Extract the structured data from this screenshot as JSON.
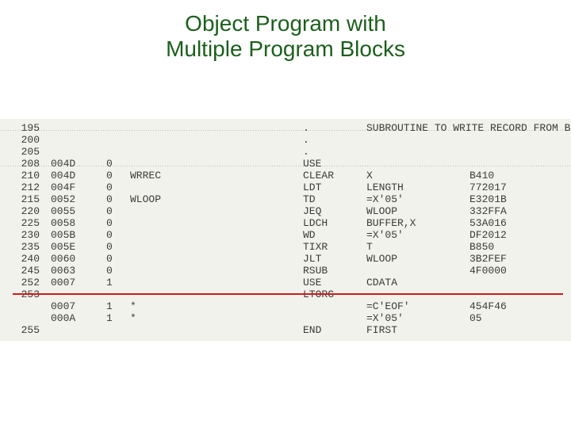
{
  "title_line1": "Object Program with",
  "title_line2": "Multiple Program Blocks",
  "rows": [
    {
      "dotted": true,
      "line": "195",
      "loc": "",
      "blk": "",
      "label": "",
      "empty": "",
      "opcode": ".",
      "operand": "SUBROUTINE TO WRITE RECORD FROM BUFFER",
      "obj": ""
    },
    {
      "dotted": false,
      "line": "200",
      "loc": "",
      "blk": "",
      "label": "",
      "empty": "",
      "opcode": ".",
      "operand": "",
      "obj": ""
    },
    {
      "dotted": false,
      "line": "205",
      "loc": "",
      "blk": "",
      "label": "",
      "empty": "",
      "opcode": ".",
      "operand": "",
      "obj": ""
    },
    {
      "dotted": true,
      "line": "208",
      "loc": "004D",
      "blk": "0",
      "label": "",
      "empty": "",
      "opcode": "USE",
      "operand": "",
      "obj": ""
    },
    {
      "dotted": false,
      "line": "210",
      "loc": "004D",
      "blk": "0",
      "label": "WRREC",
      "empty": "",
      "opcode": "CLEAR",
      "operand": "X",
      "obj": "B410"
    },
    {
      "dotted": false,
      "line": "212",
      "loc": "004F",
      "blk": "0",
      "label": "",
      "empty": "",
      "opcode": "LDT",
      "operand": "LENGTH",
      "obj": "772017"
    },
    {
      "dotted": false,
      "line": "215",
      "loc": "0052",
      "blk": "0",
      "label": "WLOOP",
      "empty": "",
      "opcode": "TD",
      "operand": "=X'05'",
      "obj": "E3201B"
    },
    {
      "dotted": false,
      "line": "220",
      "loc": "0055",
      "blk": "0",
      "label": "",
      "empty": "",
      "opcode": "JEQ",
      "operand": "WLOOP",
      "obj": "332FFA"
    },
    {
      "dotted": false,
      "line": "225",
      "loc": "0058",
      "blk": "0",
      "label": "",
      "empty": "",
      "opcode": "LDCH",
      "operand": "BUFFER,X",
      "obj": "53A016"
    },
    {
      "dotted": false,
      "line": "230",
      "loc": "005B",
      "blk": "0",
      "label": "",
      "empty": "",
      "opcode": "WD",
      "operand": "=X'05'",
      "obj": "DF2012"
    },
    {
      "dotted": false,
      "line": "235",
      "loc": "005E",
      "blk": "0",
      "label": "",
      "empty": "",
      "opcode": "TIXR",
      "operand": "T",
      "obj": "B850"
    },
    {
      "dotted": false,
      "line": "240",
      "loc": "0060",
      "blk": "0",
      "label": "",
      "empty": "",
      "opcode": "JLT",
      "operand": "WLOOP",
      "obj": "3B2FEF"
    },
    {
      "dotted": false,
      "line": "245",
      "loc": "0063",
      "blk": "0",
      "label": "",
      "empty": "",
      "opcode": "RSUB",
      "operand": "",
      "obj": "4F0000"
    },
    {
      "dotted": false,
      "line": "252",
      "loc": "0007",
      "blk": "1",
      "label": "",
      "empty": "",
      "opcode": "USE",
      "operand": "CDATA",
      "obj": ""
    },
    {
      "dotted": false,
      "line": "253",
      "loc": "",
      "blk": "",
      "label": "",
      "empty": "",
      "opcode": "LTORG",
      "operand": "",
      "obj": ""
    },
    {
      "dotted": false,
      "line": "",
      "loc": "0007",
      "blk": "1",
      "label": "*",
      "empty": "",
      "opcode": "",
      "operand": "=C'EOF'",
      "obj": "454F46"
    },
    {
      "dotted": false,
      "line": "",
      "loc": "000A",
      "blk": "1",
      "label": "*",
      "empty": "",
      "opcode": "",
      "operand": "=X'05'",
      "obj": "05"
    },
    {
      "dotted": false,
      "line": "255",
      "loc": "",
      "blk": "",
      "label": "",
      "empty": "",
      "opcode": "END",
      "operand": "FIRST",
      "obj": ""
    }
  ]
}
